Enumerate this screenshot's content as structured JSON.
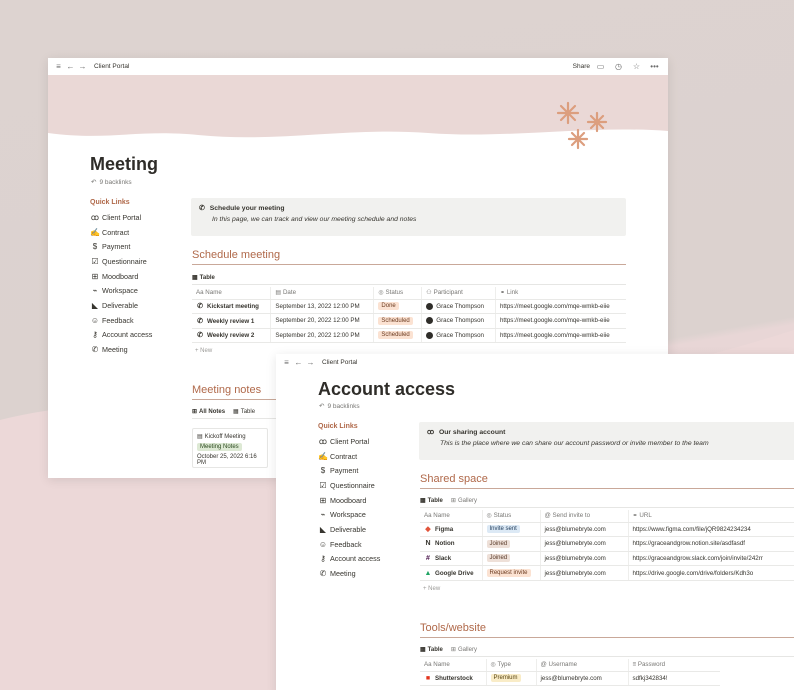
{
  "window1": {
    "breadcrumb": "Client Portal",
    "share_label": "Share",
    "title": "Meeting",
    "backlinks": "9 backlinks",
    "quick_links_heading": "Quick Links",
    "quick_links": [
      {
        "label": "Client Portal",
        "icon": "people-icon"
      },
      {
        "label": "Contract",
        "icon": "handshake-icon"
      },
      {
        "label": "Payment",
        "icon": "dollar-icon"
      },
      {
        "label": "Questionnaire",
        "icon": "checkbox-icon"
      },
      {
        "label": "Moodboard",
        "icon": "grid-icon"
      },
      {
        "label": "Workspace",
        "icon": "chart-icon"
      },
      {
        "label": "Deliverable",
        "icon": "megaphone-icon"
      },
      {
        "label": "Feedback",
        "icon": "chat-icon"
      },
      {
        "label": "Account access",
        "icon": "key-icon"
      },
      {
        "label": "Meeting",
        "icon": "phone-icon"
      }
    ],
    "callout": {
      "title": "Schedule your meeting",
      "subtitle": "In this page, we can track and view our meeting schedule and notes"
    },
    "schedule_heading": "Schedule meeting",
    "schedule_tab": "Table",
    "schedule_columns": [
      "Name",
      "Date",
      "Status",
      "Participant",
      "Link"
    ],
    "schedule_rows": [
      {
        "name": "Kickstart meeting",
        "date": "September 13, 2022 12:00 PM",
        "status": "Done",
        "participant": "Grace Thompson",
        "link": "https://meet.google.com/mqe-wmkb-eiie"
      },
      {
        "name": "Weekly review 1",
        "date": "September 20, 2022 12:00 PM",
        "status": "Scheduled",
        "participant": "Grace Thompson",
        "link": "https://meet.google.com/mqe-wmkb-eiie"
      },
      {
        "name": "Weekly review 2",
        "date": "September 20, 2022 12:00 PM",
        "status": "Scheduled",
        "participant": "Grace Thompson",
        "link": "https://meet.google.com/mqe-wmkb-eiie"
      }
    ],
    "new_label": "New",
    "notes_heading": "Meeting notes",
    "notes_tabs": [
      "All Notes",
      "Table"
    ],
    "note_card": {
      "name": "Kickoff Meeting",
      "tag": "Meeting Notes",
      "date": "October 25, 2022 6:16 PM"
    }
  },
  "window2": {
    "breadcrumb": "Client Portal",
    "title": "Account access",
    "backlinks": "9 backlinks",
    "quick_links_heading": "Quick Links",
    "quick_links": [
      {
        "label": "Client Portal",
        "icon": "people-icon"
      },
      {
        "label": "Contract",
        "icon": "handshake-icon"
      },
      {
        "label": "Payment",
        "icon": "dollar-icon"
      },
      {
        "label": "Questionnaire",
        "icon": "checkbox-icon"
      },
      {
        "label": "Moodboard",
        "icon": "grid-icon"
      },
      {
        "label": "Workspace",
        "icon": "chart-icon"
      },
      {
        "label": "Deliverable",
        "icon": "megaphone-icon"
      },
      {
        "label": "Feedback",
        "icon": "chat-icon"
      },
      {
        "label": "Account access",
        "icon": "key-icon"
      },
      {
        "label": "Meeting",
        "icon": "phone-icon"
      }
    ],
    "callout": {
      "title": "Our sharing account",
      "subtitle": "This is the place where we can share our account password or invite member to the team"
    },
    "shared_heading": "Shared space",
    "shared_tabs": [
      "Table",
      "Gallery"
    ],
    "shared_columns": [
      "Name",
      "Status",
      "Send invite to",
      "URL"
    ],
    "shared_rows": [
      {
        "name": "Figma",
        "status": "Invite sent",
        "email": "jess@blumebryte.com",
        "url": "https://www.figma.com/file/jQR9824234234"
      },
      {
        "name": "Notion",
        "status": "Joined",
        "email": "jess@blumebryte.com",
        "url": "https://graceandgrow.notion.site/asdfasdf"
      },
      {
        "name": "Slack",
        "status": "Joined",
        "email": "jess@blumebryte.com",
        "url": "https://graceandgrow.slack.com/join/invite/242rr"
      },
      {
        "name": "Google Drive",
        "status": "Request invite",
        "email": "jess@blumebryte.com",
        "url": "https://drive.google.com/drive/folders/Kdh3o"
      }
    ],
    "new_label": "New",
    "tools_heading": "Tools/website",
    "tools_tabs": [
      "Table",
      "Gallery"
    ],
    "tools_columns": [
      "Name",
      "Type",
      "Username",
      "Password"
    ],
    "tools_rows": [
      {
        "name": "Shutterstock",
        "type": "Premium",
        "username": "jess@blumebryte.com",
        "password": "sdfkj342834!"
      }
    ]
  }
}
